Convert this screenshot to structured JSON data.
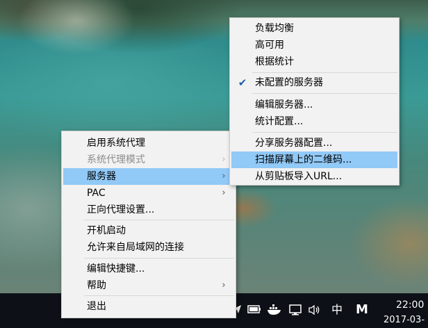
{
  "main_menu": {
    "items": [
      {
        "label": "启用系统代理"
      },
      {
        "label": "系统代理模式"
      },
      {
        "label": "服务器"
      },
      {
        "label": "PAC"
      },
      {
        "label": "正向代理设置..."
      },
      {
        "label": "开机启动"
      },
      {
        "label": "允许来自局域网的连接"
      },
      {
        "label": "编辑快捷键..."
      },
      {
        "label": "帮助"
      },
      {
        "label": "退出"
      }
    ]
  },
  "server_menu": {
    "items": [
      {
        "label": "负载均衡"
      },
      {
        "label": "高可用"
      },
      {
        "label": "根据统计"
      },
      {
        "label": "未配置的服务器",
        "checked": true
      },
      {
        "label": "编辑服务器..."
      },
      {
        "label": "统计配置..."
      },
      {
        "label": "分享服务器配置..."
      },
      {
        "label": "扫描屏幕上的二维码..."
      },
      {
        "label": "从剪贴板导入URL..."
      }
    ]
  },
  "taskbar": {
    "ime_label": "中",
    "m_label": "M",
    "clock_time": "22:00",
    "clock_date": "2017-03-"
  },
  "colors": {
    "menu_bg": "#f2f2f2",
    "highlight": "#91c9f7",
    "disabled_text": "#8d8d8d",
    "taskbar_bg": "#0d1117"
  },
  "icons": {
    "check": "check-icon",
    "submenu": "chevron-right-icon",
    "tray": [
      "send-icon",
      "battery-icon",
      "docker-whale-icon",
      "network-icon",
      "volume-icon"
    ]
  }
}
